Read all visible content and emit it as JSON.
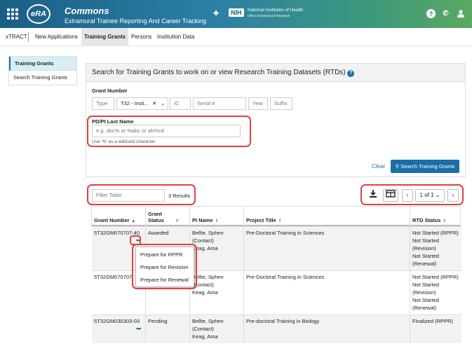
{
  "header": {
    "logo": "eRA",
    "title": "Commons",
    "subtitle": "Extramural Trainee Reporting And Career Tracking",
    "nih": "NIH",
    "nih_name": "National Institutes of Health",
    "nih_office": "Office of Extramural Research"
  },
  "tabs": {
    "app_name": "xTRACT",
    "items": [
      "New Applications",
      "Training Grants",
      "Persons",
      "Institution Data"
    ],
    "active": "Training Grants"
  },
  "sidenav": {
    "items": [
      "Training Grants",
      "Search Training Grants"
    ]
  },
  "search": {
    "heading": "Search for Training Grants to work on or view Research Training Datasets (RTDs)",
    "grant_number_label": "Grant Number",
    "type_placeholder": "Type",
    "activity_value": "T32 - Insti...",
    "ic_placeholder": "IC",
    "serial_placeholder": "Serial #",
    "year_placeholder": "Year",
    "suffix_placeholder": "Suffix",
    "pi_label": "PD/PI Last Name",
    "pi_placeholder": "e.g. abc% or %abc or ab%cd",
    "pi_hint": "Use '%' as a wildcard character.",
    "clear_label": "Clear",
    "search_label": "Search Training Grants"
  },
  "table_tools": {
    "filter_placeholder": "Filter Table",
    "results": "3 Results",
    "pagination": "1 of 1"
  },
  "table": {
    "columns": [
      "Grant Number",
      "Grant Status",
      "PI Name",
      "Project Title",
      "RTD Status"
    ],
    "rows": [
      {
        "grant": "5T32GM070707-40",
        "status": "Awarded",
        "pi_1": "Bellte, Sphen",
        "pi_2": "(Contact)",
        "pi_3": "Keag, Ama",
        "title": "Pre-Doctoral Training in Sciences",
        "rtd": [
          "Not Started (RPPR)",
          "Not Started (Revision)",
          "Not Started (Renewal)"
        ]
      },
      {
        "grant": "5T32GM070707",
        "status": "",
        "pi_1": "Bellte, Sphen",
        "pi_2": "(Contact)",
        "pi_3": "Keag, Ama",
        "title": "Pre-Doctoral Training in Sciences",
        "rtd": [
          "Not Started (RPPR)",
          "Not Started (Revision)",
          "Not Started (Renewal)"
        ]
      },
      {
        "grant": "5T32GM030303-03",
        "status": "Pending",
        "pi_1": "Bellte, Sphen",
        "pi_2": "(Contact)",
        "pi_3": "Keag, Ama",
        "title": "Pre-doctoral Training in Biology",
        "rtd": [
          "Finalized (RPPR)"
        ]
      }
    ]
  },
  "action_menu": {
    "items": [
      "Prepare for RPPR",
      "Prepare for Revision",
      "Prepare for Renewal"
    ]
  },
  "colors": {
    "accent": "#1a6fa6",
    "highlight": "#e04040"
  }
}
